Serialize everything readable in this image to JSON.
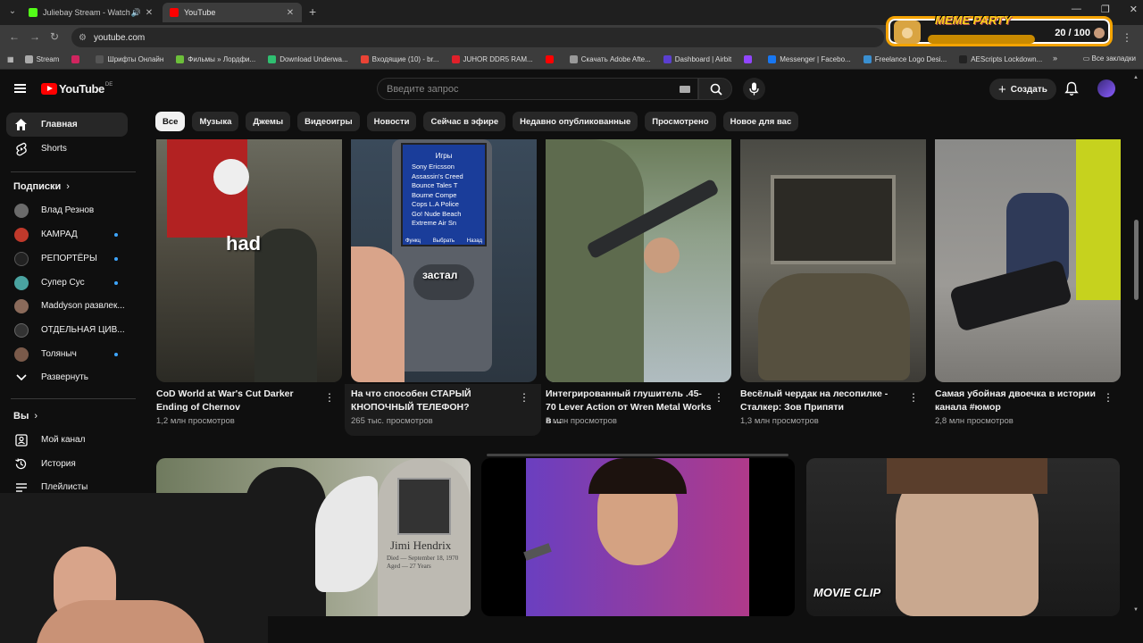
{
  "browser": {
    "tabs": [
      {
        "title": "Juliebay Stream - Watch Li",
        "favicon": "kick-icon"
      },
      {
        "title": "YouTube",
        "favicon": "youtube-icon"
      }
    ],
    "url": "youtube.com",
    "bookmarks": [
      "Stream",
      "Шрифты Онлайн",
      "Фильмы » Лордфи...",
      "Download Underwa...",
      "Входящие (10) - br...",
      "JUHOR DDR5 RAM...",
      "Скачать Adobe Afte...",
      "Dashboard | Airbit",
      "Messenger | Facebo...",
      "Freelance Logo Desi...",
      "AEScripts Lockdown..."
    ],
    "all_bookmarks": "Все закладки"
  },
  "overlay": {
    "title": "MEME PARTY",
    "count": "20 / 100"
  },
  "header": {
    "logo": "YouTube",
    "country": "DE",
    "search_placeholder": "Введите запрос",
    "create_label": "Создать"
  },
  "sidebar": {
    "main": [
      {
        "label": "Главная",
        "icon": "home-icon"
      },
      {
        "label": "Shorts",
        "icon": "shorts-icon"
      }
    ],
    "subs_title": "Подписки",
    "subs": [
      {
        "label": "Влад Резнов",
        "color": "#6b6b6b",
        "dot": false
      },
      {
        "label": "КАМРАД",
        "color": "#c0392b",
        "dot": true
      },
      {
        "label": "РЕПОРТЁРЫ",
        "color": "#222222",
        "dot": true
      },
      {
        "label": "Супер Сус",
        "color": "#4aa3a0",
        "dot": true
      },
      {
        "label": "Maddyson развлек...",
        "color": "#8a6a5a",
        "dot": false
      },
      {
        "label": "ОТДЕЛЬНАЯ ЦИВ...",
        "color": "#333333",
        "dot": false
      },
      {
        "label": "Толяныч",
        "color": "#7a5a4a",
        "dot": true
      }
    ],
    "expand": "Развернуть",
    "you_title": "Вы",
    "you": [
      {
        "label": "Мой канал",
        "icon": "channel-icon"
      },
      {
        "label": "История",
        "icon": "history-icon"
      },
      {
        "label": "Плейлисты",
        "icon": "playlists-icon"
      }
    ]
  },
  "chips": [
    "Все",
    "Музыка",
    "Джемы",
    "Видеоигры",
    "Новости",
    "Сейчас в эфире",
    "Недавно опубликованные",
    "Просмотрено",
    "Новое для вас"
  ],
  "shorts": [
    {
      "title": "CoD World at War's Cut Darker Ending of Chernov",
      "views": "1,2 млн просмотров",
      "overlay": "had"
    },
    {
      "title": "На что способен СТАРЫЙ КНОПОЧНЫЙ ТЕЛЕФОН?",
      "views": "265 тыс. просмотров",
      "overlay": "застал"
    },
    {
      "title": "Интегрированный глушитель .45-70 Lever Action от Wren Metal Works в ...",
      "views": "5 млн просмотров"
    },
    {
      "title": "Весёлый чердак на лесопилке - Сталкер: Зов Припяти",
      "views": "1,3 млн просмотров"
    },
    {
      "title": "Самая убойная двоечка в истории канала #юмор",
      "views": "2,8 млн просмотров"
    }
  ],
  "phone_menu": {
    "header": "Игры",
    "items": [
      "Sony Ericsson",
      "Assassin's Creed",
      "Bounce Tales T",
      "Bourne Compe",
      "Cops L.A Police",
      "Go! Nude Beach",
      "Extreme Air Sn"
    ],
    "soft_left": "Функц",
    "soft_mid": "Выбрать",
    "soft_right": "Назад"
  },
  "videos": [
    {
      "overlay": "Jimi Hendrix",
      "sub": "Died — September 18, 1970\nAged — 27 Years"
    },
    {
      "overlay": ""
    },
    {
      "overlay": "MOVIE CLIP"
    }
  ]
}
